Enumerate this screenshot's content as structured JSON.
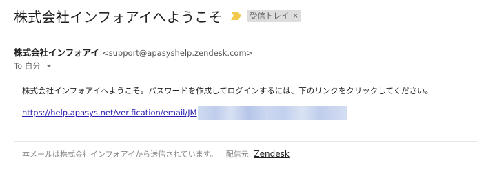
{
  "email": {
    "subject": "株式会社インフォアイへようこそ",
    "label": {
      "text": "受信トレイ",
      "remove_glyph": "×"
    },
    "importance_marker_color": "#f2c94c",
    "sender": {
      "name": "株式会社インフォアイ",
      "email": "<support@apasyshelp.zendesk.com>"
    },
    "recipient": {
      "text": "To 自分"
    },
    "body": {
      "message": "株式会社インフォアイへようこそ。パスワードを作成してログインするには、下のリンクをクリックしてください。",
      "link_visible_text": "https://help.apasys.net/verification/email/JM"
    },
    "footer": {
      "notice": "本メールは株式会社インフォアイから送信されています。",
      "delivered_by_label": "配信元:",
      "delivered_by_link": "Zendesk"
    }
  },
  "colors": {
    "link": "#2a1fb2",
    "chip_background": "#dddddd",
    "divider": "#e5e5e5"
  }
}
